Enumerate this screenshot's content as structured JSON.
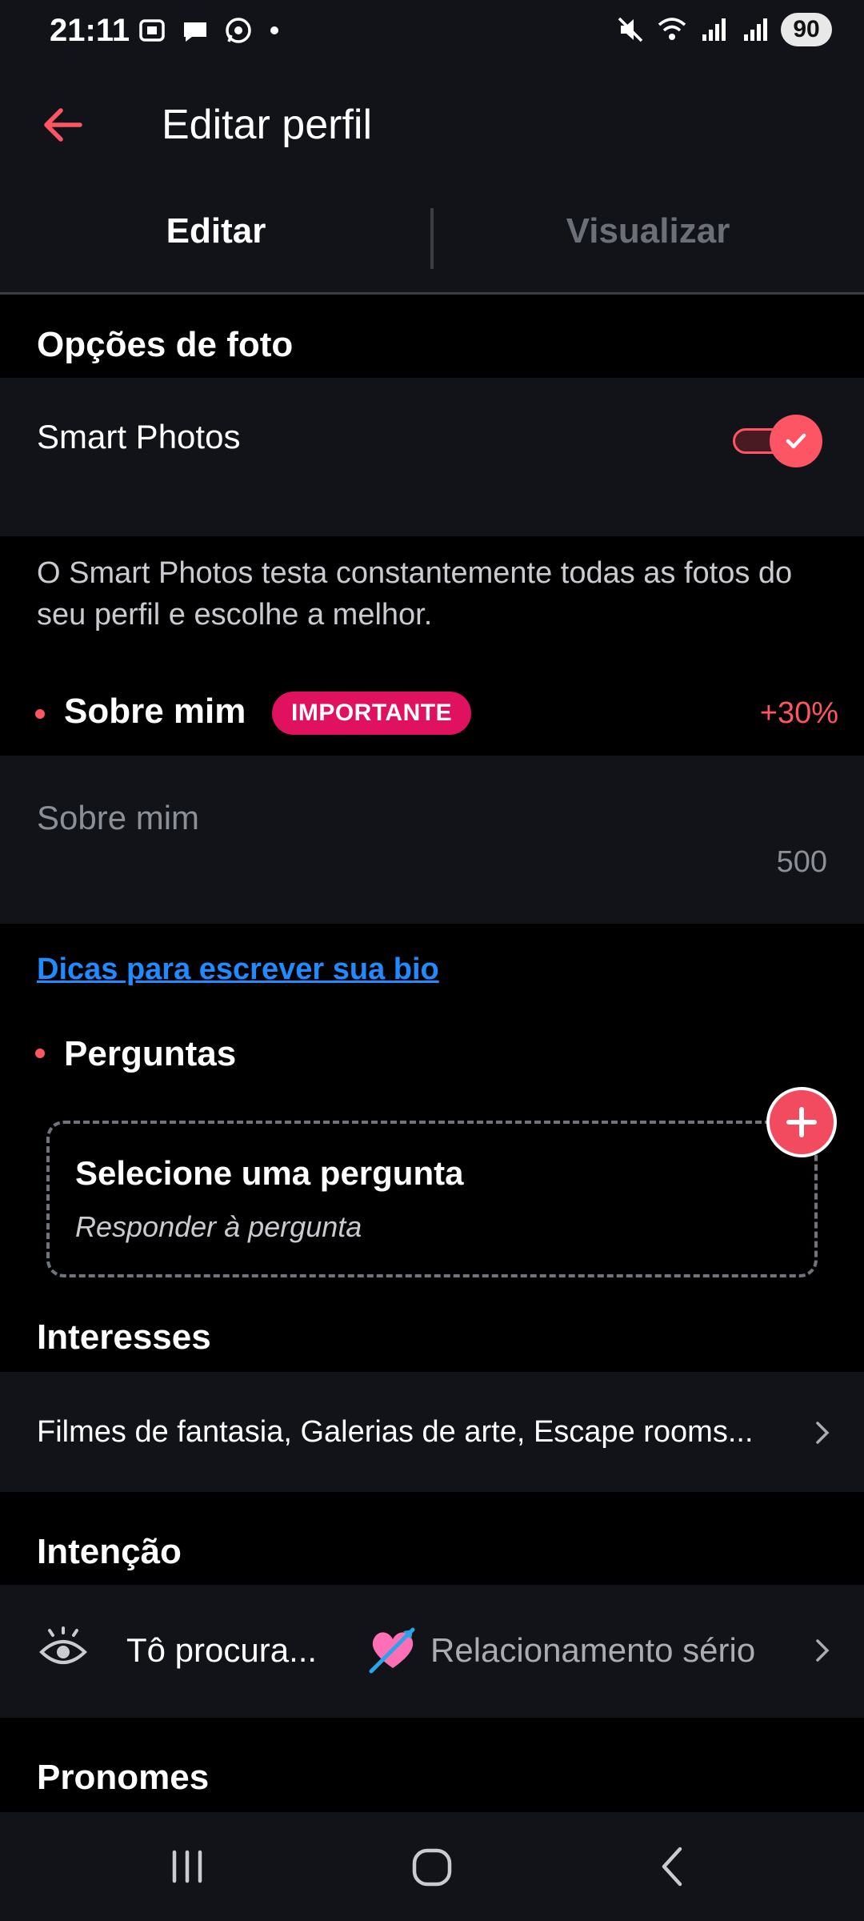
{
  "status_bar": {
    "time": "21:11",
    "battery": "90"
  },
  "header": {
    "title": "Editar perfil"
  },
  "tabs": [
    {
      "label": "Editar"
    },
    {
      "label": "Visualizar"
    }
  ],
  "photo_options": {
    "title": "Opções de foto",
    "smart_photos_label": "Smart Photos",
    "smart_photos_enabled": true,
    "description": "O Smart Photos testa constantemente todas as fotos do seu perfil e escolhe a melhor."
  },
  "about": {
    "title": "Sobre mim",
    "badge": "IMPORTANTE",
    "boost": "+30%",
    "placeholder": "Sobre mim",
    "char_count": "500",
    "tips_link": "Dicas para escrever sua bio"
  },
  "questions": {
    "title": "Perguntas",
    "select_label": "Selecione uma pergunta",
    "answer_label": "Responder à pergunta"
  },
  "interests": {
    "title": "Interesses",
    "value": "Filmes de fantasia, Galerias de arte, Escape rooms..."
  },
  "intention": {
    "title": "Intenção",
    "label": "Tô procura...",
    "value": "Relacionamento sério"
  },
  "pronouns": {
    "title": "Pronomes"
  },
  "colors": {
    "accent": "#fd5564",
    "badge": "#e0115f",
    "link": "#1f8bff",
    "card": "#111318"
  },
  "icons": [
    "back-arrow-icon",
    "eye-icon",
    "heart-arrow-icon",
    "chevron-right-icon",
    "plus-icon",
    "check-icon"
  ]
}
